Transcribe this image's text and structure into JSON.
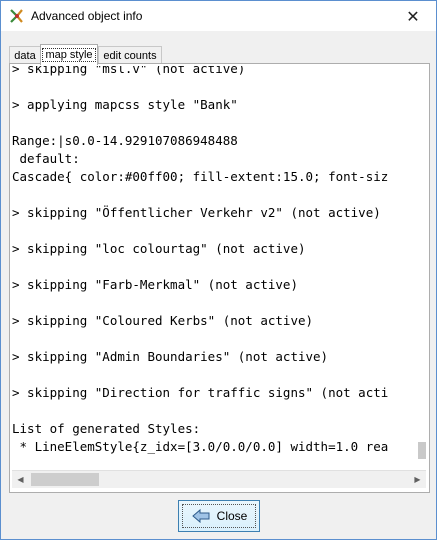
{
  "window": {
    "title": "Advanced object info",
    "close_glyph": "✕"
  },
  "tabs": [
    {
      "label": "data",
      "active": false
    },
    {
      "label": "map style",
      "active": true
    },
    {
      "label": "edit counts",
      "active": false
    }
  ],
  "content_lines": [
    "> skipping \"msl.v\" (not active)",
    "",
    "> applying mapcss style \"Bank\"",
    "",
    "Range:|s0.0-14.929107086948488",
    " default:",
    "Cascade{ color:#00ff00; fill-extent:15.0; font-siz",
    "",
    "> skipping \"Öffentlicher Verkehr v2\" (not active)",
    "",
    "> skipping \"loc colourtag\" (not active)",
    "",
    "> skipping \"Farb-Merkmal\" (not active)",
    "",
    "> skipping \"Coloured Kerbs\" (not active)",
    "",
    "> skipping \"Admin Boundaries\" (not active)",
    "",
    "> skipping \"Direction for traffic signs\" (not acti",
    "",
    "List of generated Styles:",
    " * LineElemStyle{z_idx=[3.0/0.0/0.0] width=1.0 rea"
  ],
  "buttons": {
    "close_label": "Close"
  },
  "scrollbar": {
    "left_arrow": "◀",
    "right_arrow": "▶",
    "thumb_fraction": 0.17
  },
  "colors": {
    "window_border": "#5b8fcf",
    "button_border": "#3c7fb1"
  }
}
